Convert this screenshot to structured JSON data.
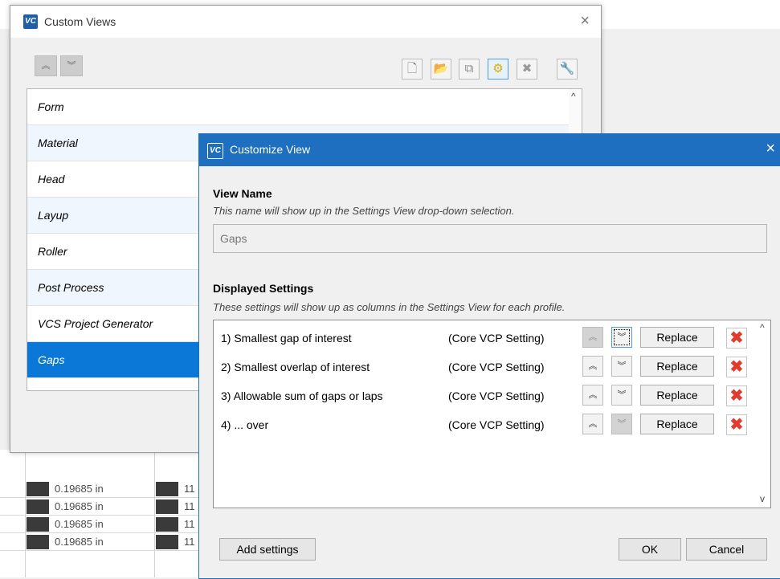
{
  "custom_views": {
    "title": "Custom Views",
    "close": "×",
    "move_up": "︽",
    "move_down": "︾",
    "toolbar": {
      "new": "🗋",
      "open": "📂",
      "rename": "⧉",
      "customize": "⚙",
      "delete": "✖",
      "settings": "🔧"
    },
    "items": [
      "Form",
      "Material",
      "Head",
      "Layup",
      "Roller",
      "Post Process",
      "VCS Project Generator",
      "Gaps"
    ],
    "selected": "Gaps",
    "scroll_up": "^"
  },
  "customize_view": {
    "title": "Customize View",
    "close": "×",
    "view_name_heading": "View Name",
    "view_name_hint": "This name will show up in the Settings View drop-down selection.",
    "view_name_value": "Gaps",
    "displayed_heading": "Displayed Settings",
    "displayed_hint": "These settings will show up as columns in the Settings View for each profile.",
    "settings": [
      {
        "name": "1) Smallest gap of interest",
        "source": "(Core VCP Setting)"
      },
      {
        "name": "2) Smallest overlap of interest",
        "source": "(Core VCP Setting)"
      },
      {
        "name": "3) Allowable sum of gaps or laps",
        "source": "(Core VCP Setting)"
      },
      {
        "name": "4) ... over",
        "source": "(Core VCP Setting)"
      }
    ],
    "up_glyph": "︽",
    "down_glyph": "︾",
    "replace_label": "Replace",
    "delete_glyph": "✖",
    "scroll_up": "^",
    "scroll_down": "v",
    "add_settings": "Add settings",
    "ok": "OK",
    "cancel": "Cancel"
  },
  "background": {
    "values": [
      "0.19685 in",
      "0.19685 in",
      "0.19685 in",
      "0.19685 in"
    ],
    "col2": [
      "11",
      "11",
      "11",
      "11"
    ]
  },
  "colors": {
    "selection": "#0b78d7",
    "title_bar": "#1e6fbf",
    "delete_red": "#e23b2e"
  }
}
